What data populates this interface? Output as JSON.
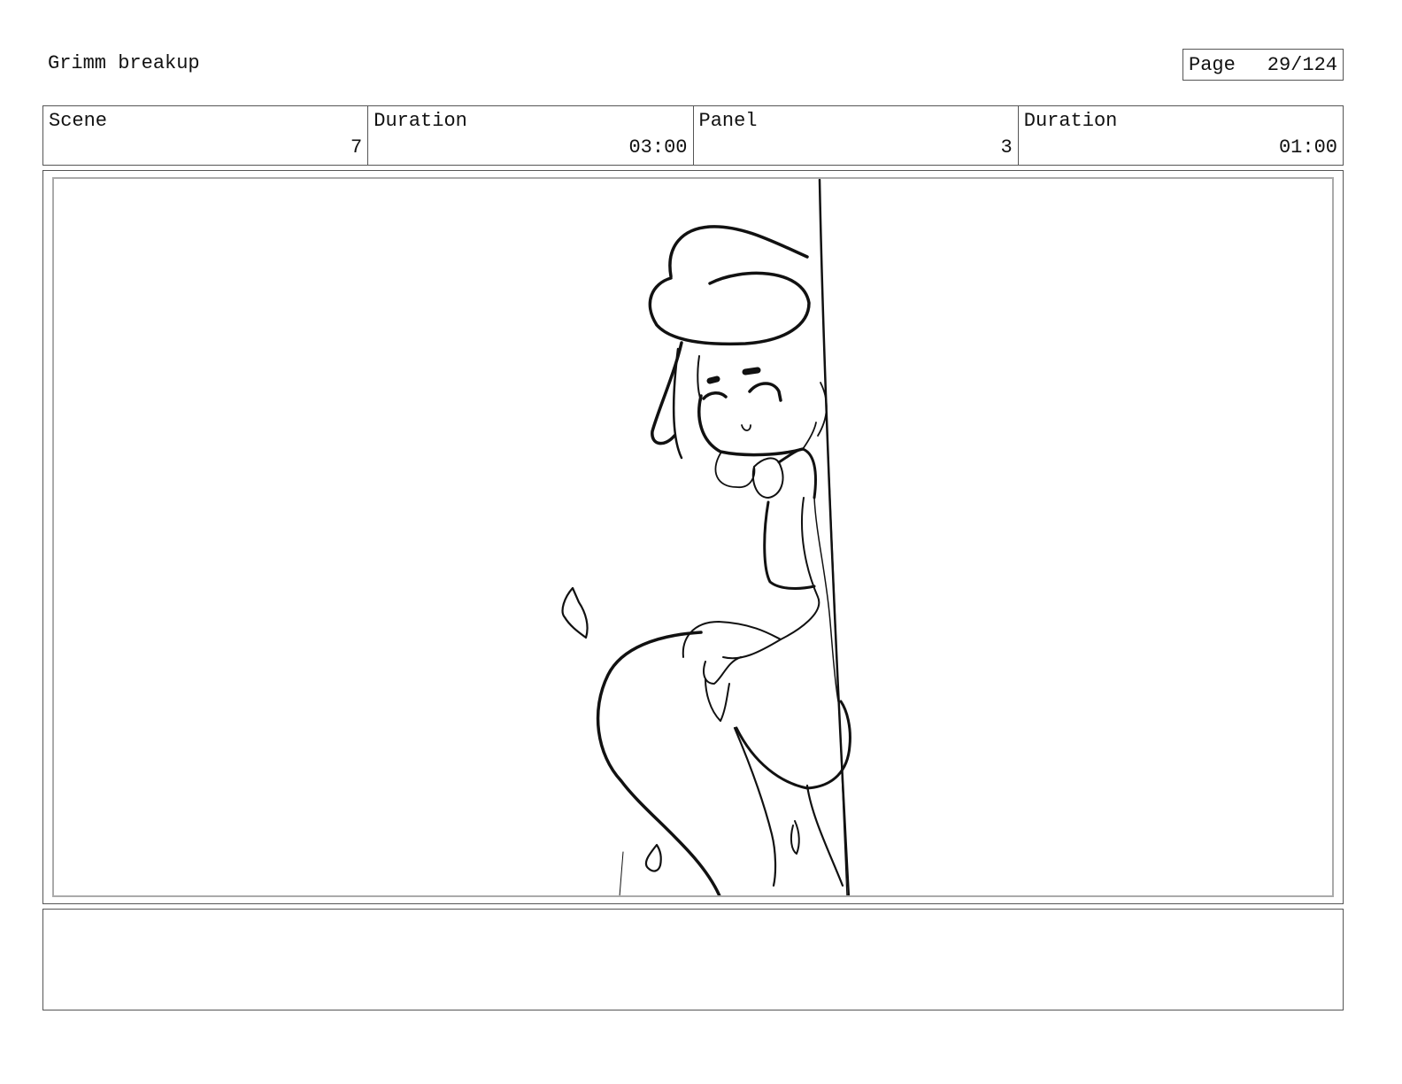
{
  "header": {
    "title": "Grimm breakup",
    "page_label": "Page",
    "page_number": "29/124"
  },
  "info": {
    "scene_label": "Scene",
    "scene_value": "7",
    "scene_duration_label": "Duration",
    "scene_duration_value": "03:00",
    "panel_label": "Panel",
    "panel_value": "3",
    "panel_duration_label": "Duration",
    "panel_duration_value": "01:00"
  },
  "panel": {
    "drawing": "character-sketch-peeking-from-wall"
  },
  "notes": {
    "text": ""
  }
}
